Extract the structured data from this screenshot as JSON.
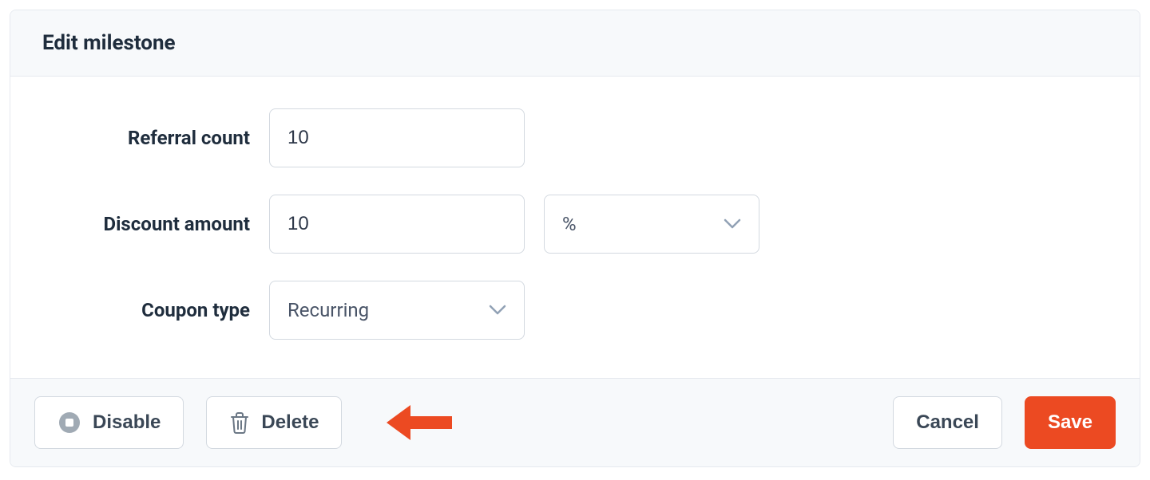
{
  "header": {
    "title": "Edit milestone"
  },
  "form": {
    "referral_count": {
      "label": "Referral count",
      "value": "10"
    },
    "discount_amount": {
      "label": "Discount amount",
      "value": "10",
      "unit_value": "%"
    },
    "coupon_type": {
      "label": "Coupon type",
      "value": "Recurring"
    }
  },
  "footer": {
    "disable_label": "Disable",
    "delete_label": "Delete",
    "cancel_label": "Cancel",
    "save_label": "Save"
  },
  "colors": {
    "accent": "#ec4a22",
    "icon_muted": "#a0aab4",
    "chevron": "#91a1b5",
    "border": "#d3d9e0",
    "text": "#1f2d3d"
  }
}
